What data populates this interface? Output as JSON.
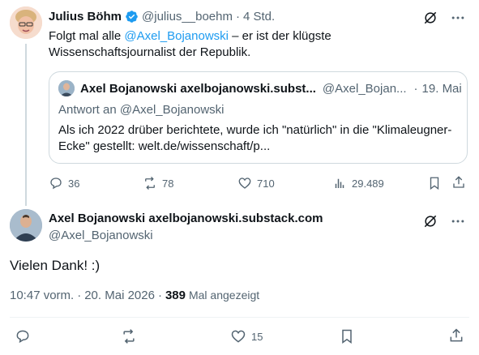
{
  "tweet1": {
    "author_name": "Julius Böhm",
    "verified": true,
    "handle": "@julius__boehm",
    "separator": "·",
    "time": "4 Std.",
    "text_before": "Folgt mal alle ",
    "mention": "@Axel_Bojanowski",
    "text_after": " – er ist der klügste Wissenschaftsjournalist der Republik.",
    "quote": {
      "author_name": "Axel Bojanowski axelbojanowski.subst...",
      "handle": "@Axel_Bojan...",
      "separator": "·",
      "date": "19. Mai",
      "reply_to": "Antwort an @Axel_Bojanowski",
      "text": "Als ich 2022 drüber berichtete, wurde ich \"natürlich\" in die \"Klimaleugner-Ecke\" gestellt: welt.de/wissenschaft/p..."
    },
    "metrics": {
      "replies": "36",
      "retweets": "78",
      "likes": "710",
      "views": "29.489"
    }
  },
  "tweet2": {
    "author_name": "Axel Bojanowski axelbojanowski.substack.com",
    "handle": "@Axel_Bojanowski",
    "text": "Vielen Dank! :)",
    "time": "10:47 vorm.",
    "separator1": "·",
    "date": "20. Mai 2026",
    "separator2": "·",
    "views_count": "389",
    "views_label": "Mal angezeigt",
    "metrics": {
      "likes": "15"
    }
  },
  "colors": {
    "accent": "#1d9bf0",
    "muted": "#536471",
    "border": "#cfd9de"
  }
}
